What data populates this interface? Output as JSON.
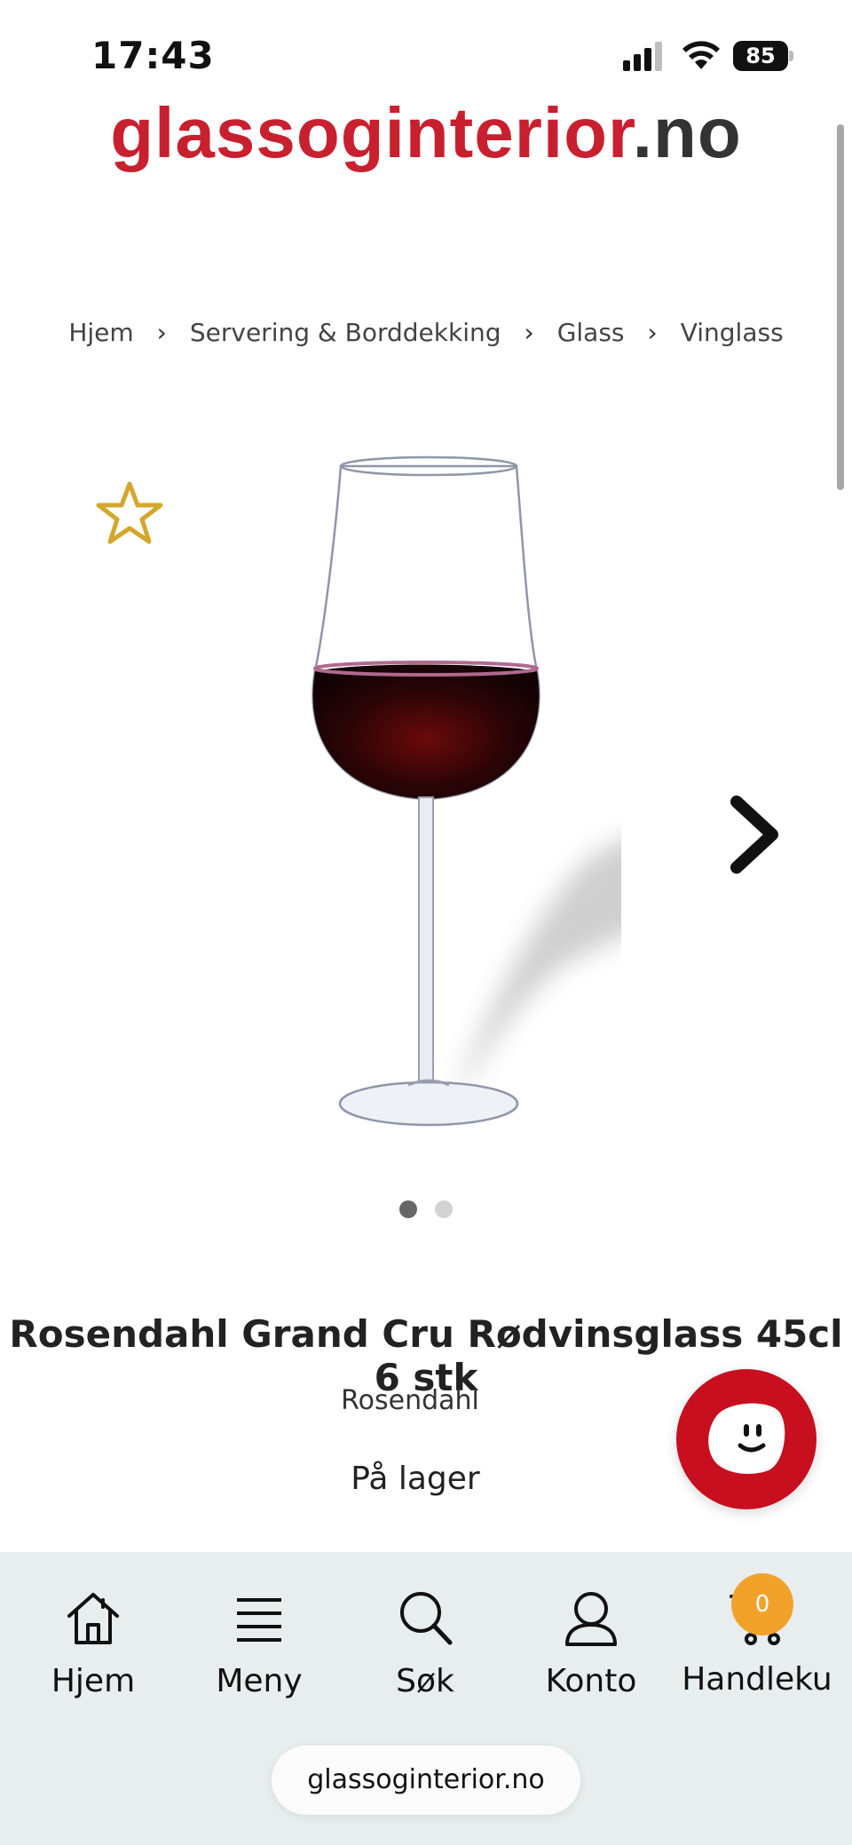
{
  "status_bar": {
    "time": "17:43",
    "battery": "85",
    "icons": [
      "signal-icon",
      "wifi-icon",
      "battery-icon"
    ]
  },
  "header": {
    "logo_main": "glassoginterior",
    "logo_tld": ".no"
  },
  "breadcrumb": {
    "items": [
      "Hjem",
      "Servering & Borddekking",
      "Glass",
      "Vinglass"
    ],
    "separator": "›"
  },
  "gallery": {
    "favorite_icon": "star-outline-icon",
    "next_icon": "chevron-right-icon",
    "slide_count": 2,
    "active_slide": 1
  },
  "product": {
    "title": "Rosendahl Grand Cru Rødvinsglass 45cl 6 stk",
    "brand": "Rosendahl",
    "stock_status": "På lager"
  },
  "chat": {
    "icon": "chat-face-icon",
    "color": "#c70f1f"
  },
  "bottom_nav": {
    "items": [
      {
        "label": "Hjem",
        "icon": "home-icon"
      },
      {
        "label": "Meny",
        "icon": "menu-icon"
      },
      {
        "label": "Søk",
        "icon": "search-icon"
      },
      {
        "label": "Konto",
        "icon": "user-icon"
      },
      {
        "label": "Handlekurv",
        "icon": "cart-icon"
      }
    ],
    "cart_count": "0"
  },
  "browser": {
    "url": "glassoginterior.no"
  },
  "colors": {
    "brand_red": "#c8202e",
    "favorite_gold": "#d4a72c",
    "badge_orange": "#f2a22a",
    "nav_background": "#e8edee"
  }
}
